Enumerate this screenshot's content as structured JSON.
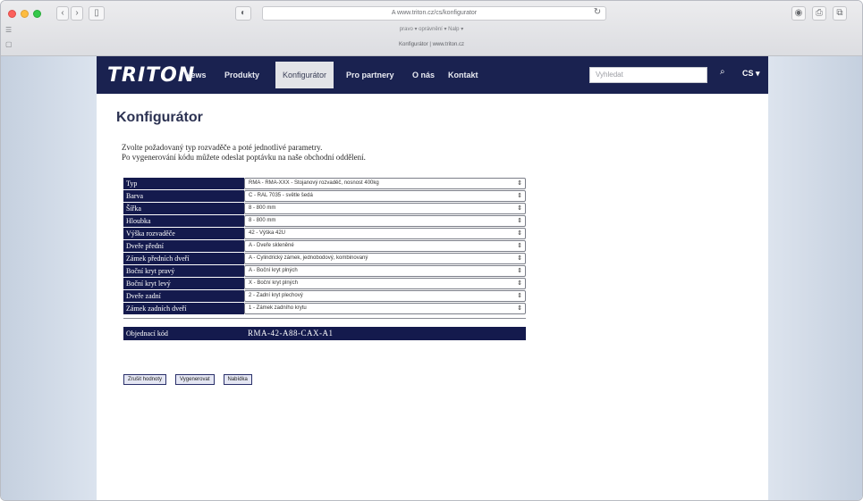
{
  "browser": {
    "address": "A www.triton.cz/cs/konfigurator",
    "bookmarks": "pravo ▾   oprávnění ▾   Nalp ▾",
    "tab_title": "Konfigurátor | www.triton.cz",
    "nav_back": "‹",
    "nav_forward": "›",
    "sidebar_btn": "▯",
    "reload": "↻",
    "share": "⎙",
    "tabs_btn": "⧉",
    "left_glyph_1": "☰",
    "left_glyph_2": "▢"
  },
  "site": {
    "logo": "TRITON",
    "nav": [
      "News",
      "Produkty",
      "Konfigurátor",
      "Pro partnery",
      "O nás",
      "Kontakt"
    ],
    "active_nav": "Konfigurátor",
    "search_placeholder": "Vyhledat",
    "search_icon": "search-icon",
    "lang": "CS ▾"
  },
  "main": {
    "title": "Konfigurátor",
    "intro_line_1": "Zvolte požadovaný typ rozvaděče a poté jednotlivé parametry.",
    "intro_line_2": "Po vygenerování kódu můžete odeslat poptávku na naše obchodní oddělení."
  },
  "config_rows": [
    {
      "label": "Typ",
      "value": "RMA - RMA-XXX - Stojanový rozvaděč, nosnost 400kg"
    },
    {
      "label": "Barva",
      "value": "C - RAL 7035 - světle šedá"
    },
    {
      "label": "Šířka",
      "value": "8 - 800 mm"
    },
    {
      "label": "Hloubka",
      "value": "8 - 800 mm"
    },
    {
      "label": "Výška rozvaděče",
      "value": "42 - Výška 42U"
    },
    {
      "label": "Dveře přední",
      "value": "A - Dveře skleněné"
    },
    {
      "label": "Zámek předních dveří",
      "value": "A - Cylindrický zámek, jednobodový, kombinovaný"
    },
    {
      "label": "Boční kryt pravý",
      "value": "A - Boční kryt plných"
    },
    {
      "label": "Boční kryt levý",
      "value": "X - Boční kryt plných"
    },
    {
      "label": "Dveře zadní",
      "value": "2 - Zadní kryt plechový"
    },
    {
      "label": "Zámek zadních dveří",
      "value": "1 - Zámek zadního krytu"
    }
  ],
  "order_code": {
    "label": "Objednací kód",
    "value": "RMA-42-A88-CAX-A1"
  },
  "buttons": {
    "reset": "Zrušit hodnoty",
    "generate": "Vygenerovat",
    "submit": "Nabídka"
  }
}
